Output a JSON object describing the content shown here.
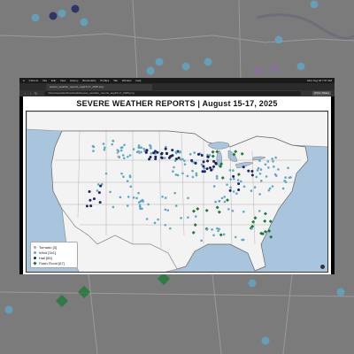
{
  "browser": {
    "menu_items": [
      "Chrome",
      "File",
      "Edit",
      "View",
      "History",
      "Bookmarks",
      "Profiles",
      "Tab",
      "Window",
      "Help"
    ],
    "clock": "Mon Aug 18  7:57 AM",
    "tab_title": "severe_weather_reports_aug15-17_2025.png",
    "url": "/Users/weather/Downloads/severe_weather_reports_aug15-17_2025.png",
    "share_button": "Print / Share"
  },
  "figure": {
    "title": "SEVERE WEATHER REPORTS | August 15-17, 2025"
  },
  "legend": [
    {
      "label": "Tornado [3]",
      "color": "#a8a8a8",
      "shape": "circle"
    },
    {
      "label": "Wind [341]",
      "color": "#5fa8c8",
      "shape": "circle"
    },
    {
      "label": "Hail [85]",
      "color": "#1c2463",
      "shape": "circle"
    },
    {
      "label": "Flash Flood [67]",
      "color": "#1e7a3a",
      "shape": "diamond"
    }
  ],
  "colors": {
    "tornado": "#a8a8a8",
    "wind": "#5fa8c8",
    "hail": "#1c2463",
    "flood": "#1e7a3a",
    "land": "#f3f3f3",
    "water": "#a9c4dd"
  }
}
